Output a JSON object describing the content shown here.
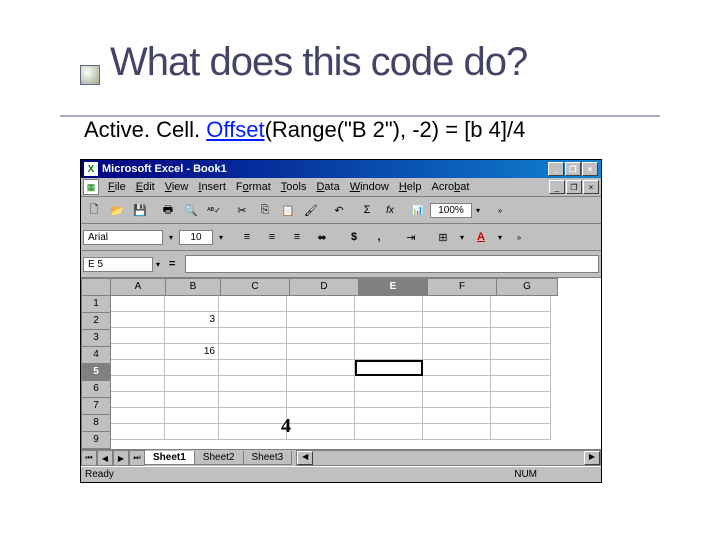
{
  "slide": {
    "title": "What does this code do?",
    "code_prefix": "Active. Cell. ",
    "code_hl": "Offset",
    "code_suffix": "(Range(\"B 2\"), -2) = [b 4]/4"
  },
  "excel": {
    "title": "Microsoft Excel - Book1",
    "menus": [
      "File",
      "Edit",
      "View",
      "Insert",
      "Format",
      "Tools",
      "Data",
      "Window",
      "Help",
      "Acrobat"
    ],
    "zoom": "100%",
    "font": "Arial",
    "size": "10",
    "namebox": "E 5",
    "formula": "",
    "columns": [
      "A",
      "B",
      "C",
      "D",
      "E",
      "F",
      "G"
    ],
    "rows": [
      "1",
      "2",
      "3",
      "4",
      "5",
      "6",
      "7",
      "8",
      "9"
    ],
    "active_col": "E",
    "active_row": "5",
    "cells": {
      "B2": "3",
      "B4": "16"
    },
    "sheets": [
      "Sheet1",
      "Sheet2",
      "Sheet3"
    ],
    "active_sheet": "Sheet1",
    "status": "Ready",
    "numlock": "NUM",
    "overlay_4": "4"
  }
}
